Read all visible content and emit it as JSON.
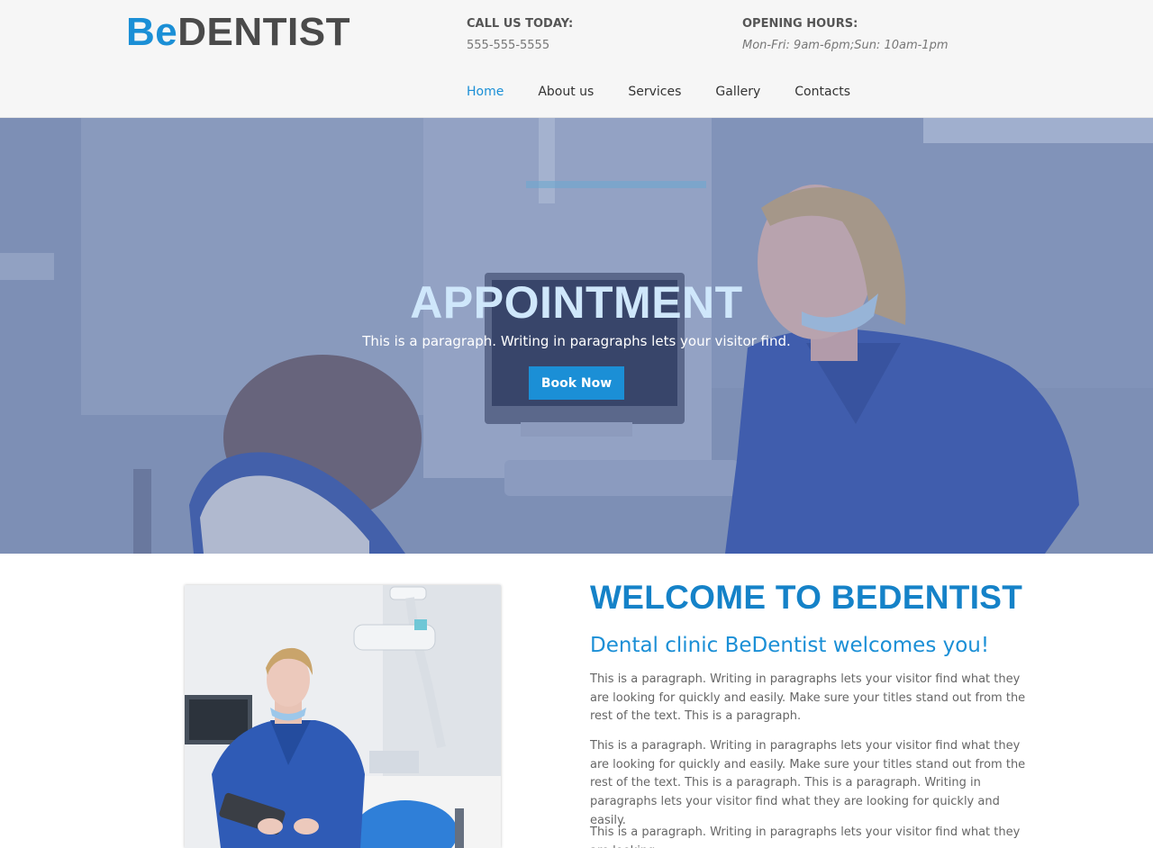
{
  "header": {
    "logo": {
      "part1": "Be",
      "part2": "DENTIST"
    },
    "call": {
      "label": "CALL US TODAY:",
      "value": "555-555-5555"
    },
    "hours": {
      "label": "OPENING HOURS:",
      "value": "Mon-Fri: 9am-6pm;Sun: 10am-1pm"
    },
    "nav": [
      "Home",
      "About us",
      "Services",
      "Gallery",
      "Contacts"
    ],
    "active_nav": "Home"
  },
  "hero": {
    "title": "APPOINTMENT",
    "text": "This is a paragraph. Writing in paragraphs lets your visitor find.",
    "button": "Book Now"
  },
  "main": {
    "title": "WELCOME TO BEDENTIST",
    "subtitle": "Dental clinic BeDentist welcomes you!",
    "paragraphs": [
      "This is a paragraph. Writing in paragraphs lets your visitor find what they are looking for quickly and easily. Make sure your titles stand out from the rest of the text. This is a paragraph.",
      "This is a paragraph. Writing in paragraphs lets your visitor find what they are looking for quickly and easily. Make sure your titles stand out from the rest of the text. This is a paragraph.  This is a paragraph. Writing in paragraphs lets your visitor find what they are looking for quickly and easily.",
      "This is a paragraph. Writing in paragraphs lets your visitor find what they are looking"
    ]
  },
  "colors": {
    "accent": "#1b8fd6",
    "title_blue": "#1582c8",
    "logo_dark": "#4a4a4a",
    "hero_tint": "#7f90b3"
  }
}
